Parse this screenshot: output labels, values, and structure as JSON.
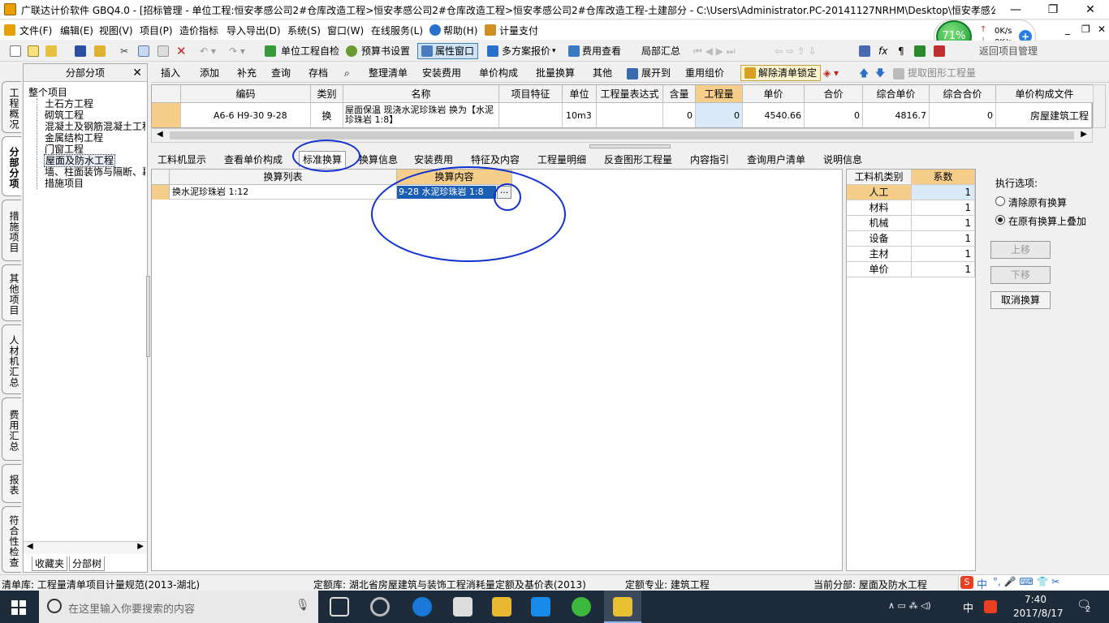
{
  "window": {
    "title": "广联达计价软件 GBQ4.0 - [招标管理 - 单位工程:恒安孝感公司2#仓库改造工程>恒安孝感公司2#仓库改造工程>恒安孝感公司2#仓库改造工程-土建部分 - C:\\Users\\Administrator.PC-20141127NRHM\\Desktop\\恒安孝感公..."
  },
  "menu": [
    "文件(F)",
    "编辑(E)",
    "视图(V)",
    "项目(P)",
    "造价指标",
    "导入导出(D)",
    "系统(S)",
    "窗口(W)",
    "在线服务(L)",
    "帮助(H)",
    "计量支付"
  ],
  "toolbar1": {
    "check": "单位工程自检",
    "budget": "预算书设置",
    "attr": "属性窗口",
    "multi": "多方案报价",
    "fee": "费用查看",
    "partial": "局部汇总",
    "extract": "提取图形工程量",
    "back": "返回项目管理"
  },
  "net": {
    "percent": "71%",
    "up": "0K/s",
    "down": "0K/s"
  },
  "left_tabs": [
    "工程概况",
    "分部分项",
    "措施项目",
    "其他项目",
    "人材机汇总",
    "费用汇总",
    "报表",
    "符合性检查"
  ],
  "panel": {
    "title": "分部分项",
    "tree": [
      "整个项目",
      "土石方工程",
      "砌筑工程",
      "混凝土及钢筋混凝土工程",
      "金属结构工程",
      "门窗工程",
      "屋面及防水工程",
      "墙、柱面装饰与隔断、幕墙",
      "措施项目"
    ],
    "bottom_tabs": [
      "收藏夹",
      "分部树"
    ]
  },
  "toolbar2": [
    "插入",
    "添加",
    "补充",
    "查询",
    "存档",
    "整理清单",
    "安装费用",
    "单价构成",
    "批量换算",
    "其他",
    "展开到",
    "重用组价",
    "解除清单锁定"
  ],
  "grid": {
    "headers": [
      "编码",
      "类别",
      "名称",
      "项目特征",
      "单位",
      "工程量表达式",
      "含量",
      "工程量",
      "单价",
      "合价",
      "综合单价",
      "综合合价",
      "单价构成文件"
    ],
    "row": {
      "code": "A6-6 H9-30 9-28",
      "type": "换",
      "name": "屋面保温 现浇水泥珍珠岩 换为【水泥珍珠岩 1:8】",
      "feature": "",
      "unit": "10m3",
      "expr": "",
      "content": "0",
      "qty": "0",
      "price": "4540.66",
      "total": "0",
      "comp_price": "4816.7",
      "comp_total": "0",
      "file": "房屋建筑工程"
    }
  },
  "tabs": [
    "工料机显示",
    "查看单价构成",
    "标准换算",
    "换算信息",
    "安装费用",
    "特征及内容",
    "工程量明细",
    "反查图形工程量",
    "内容指引",
    "查询用户清单",
    "说明信息"
  ],
  "sub": {
    "h1": "换算列表",
    "h2": "换算内容",
    "r1": "换水泥珍珠岩 1:12",
    "r2": "9-28  水泥珍珠岩 1:8",
    "dots": "..."
  },
  "factors": {
    "h1": "工料机类别",
    "h2": "系数",
    "rows": [
      [
        "人工",
        "1"
      ],
      [
        "材料",
        "1"
      ],
      [
        "机械",
        "1"
      ],
      [
        "设备",
        "1"
      ],
      [
        "主材",
        "1"
      ],
      [
        "单价",
        "1"
      ]
    ]
  },
  "options": {
    "title": "执行选项:",
    "o1": "清除原有换算",
    "o2": "在原有换算上叠加",
    "up": "上移",
    "down": "下移",
    "cancel": "取消换算"
  },
  "status": {
    "s1": "清单库:  工程量清单项目计量规范(2013-湖北)",
    "s2": "定额库:  湖北省房屋建筑与装饰工程消耗量定额及基价表(2013)",
    "s3": "定额专业:  建筑工程",
    "s4": "当前分部:  屋面及防水工程"
  },
  "taskbar": {
    "search": "在这里输入你要搜索的内容",
    "time": "7:40",
    "date": "2017/8/17",
    "ime": "中",
    "badge": "2"
  },
  "colors": {
    "accent": "#3c7fb1",
    "selected": "#1a5fb4",
    "highlight": "#f5cf8a",
    "circle": "#1030d0"
  }
}
